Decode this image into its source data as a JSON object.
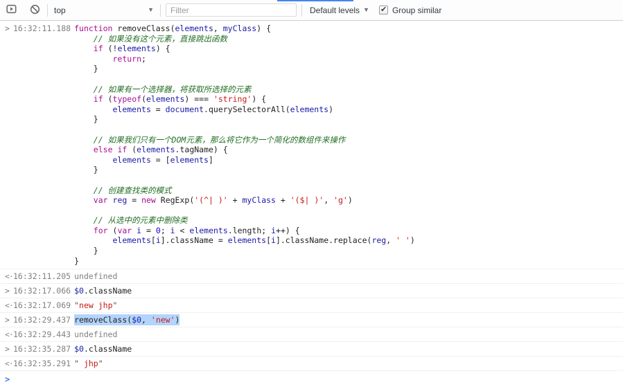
{
  "toolbar": {
    "context_selector": "top",
    "filter_placeholder": "Filter",
    "levels_label": "Default levels",
    "group_similar_label": "Group similar",
    "group_similar_checked": "✔"
  },
  "colors": {
    "accent": "#4285f4",
    "toolbar_border": "#cfcfcf",
    "row_border": "#f0f0f0",
    "keyword": "#aa0d91",
    "variable": "#1a1aa6",
    "string": "#c41a16",
    "number": "#1c00cf",
    "comment": "#236e25",
    "plain": "#222222",
    "quote": "#555555",
    "muted": "#808080",
    "prompt": "#367cf1",
    "selection": "#b3d4fc"
  },
  "console": {
    "command_glyph": ">",
    "result_glyph": "<·",
    "prompt_glyph": ">",
    "command_block": {
      "timestamp": "16:32:11.188",
      "lines": [
        [
          [
            "k",
            "function"
          ],
          [
            "pl",
            " removeClass("
          ],
          [
            "v",
            "elements"
          ],
          [
            "pl",
            ", "
          ],
          [
            "v",
            "myClass"
          ],
          [
            "pl",
            ") {"
          ]
        ],
        [
          [
            "c",
            "    // 如果没有这个元素，直接跳出函数"
          ]
        ],
        [
          [
            "pl",
            "    "
          ],
          [
            "k",
            "if"
          ],
          [
            "pl",
            " (!"
          ],
          [
            "v",
            "elements"
          ],
          [
            "pl",
            ") {"
          ]
        ],
        [
          [
            "pl",
            "        "
          ],
          [
            "k",
            "return"
          ],
          [
            "pl",
            ";"
          ]
        ],
        [
          [
            "pl",
            "    }"
          ]
        ],
        [],
        [
          [
            "c",
            "    // 如果有一个选择器，将获取所选择的元素"
          ]
        ],
        [
          [
            "pl",
            "    "
          ],
          [
            "k",
            "if"
          ],
          [
            "pl",
            " ("
          ],
          [
            "k",
            "typeof"
          ],
          [
            "pl",
            "("
          ],
          [
            "v",
            "elements"
          ],
          [
            "pl",
            ") === "
          ],
          [
            "s",
            "'string'"
          ],
          [
            "pl",
            ") {"
          ]
        ],
        [
          [
            "pl",
            "        "
          ],
          [
            "v",
            "elements"
          ],
          [
            "pl",
            " = "
          ],
          [
            "v",
            "document"
          ],
          [
            "pl",
            ".querySelectorAll("
          ],
          [
            "v",
            "elements"
          ],
          [
            "pl",
            ")"
          ]
        ],
        [
          [
            "pl",
            "    }"
          ]
        ],
        [],
        [
          [
            "c",
            "    // 如果我们只有一个DOM元素，那么将它作为一个简化的数组件来操作"
          ]
        ],
        [
          [
            "pl",
            "    "
          ],
          [
            "k",
            "else"
          ],
          [
            "pl",
            " "
          ],
          [
            "k",
            "if"
          ],
          [
            "pl",
            " ("
          ],
          [
            "v",
            "elements"
          ],
          [
            "pl",
            ".tagName) {"
          ]
        ],
        [
          [
            "pl",
            "        "
          ],
          [
            "v",
            "elements"
          ],
          [
            "pl",
            " = ["
          ],
          [
            "v",
            "elements"
          ],
          [
            "pl",
            "]"
          ]
        ],
        [
          [
            "pl",
            "    }"
          ]
        ],
        [],
        [
          [
            "c",
            "    // 创建查找类的模式"
          ]
        ],
        [
          [
            "pl",
            "    "
          ],
          [
            "k",
            "var"
          ],
          [
            "pl",
            " "
          ],
          [
            "v",
            "reg"
          ],
          [
            "pl",
            " = "
          ],
          [
            "k",
            "new"
          ],
          [
            "pl",
            " RegExp("
          ],
          [
            "s",
            "'(^| )'"
          ],
          [
            "pl",
            " + "
          ],
          [
            "v",
            "myClass"
          ],
          [
            "pl",
            " + "
          ],
          [
            "s",
            "'($| )'"
          ],
          [
            "pl",
            ", "
          ],
          [
            "s",
            "'g'"
          ],
          [
            "pl",
            ")"
          ]
        ],
        [],
        [
          [
            "c",
            "    // 从选中的元素中删除类"
          ]
        ],
        [
          [
            "pl",
            "    "
          ],
          [
            "k",
            "for"
          ],
          [
            "pl",
            " ("
          ],
          [
            "k",
            "var"
          ],
          [
            "pl",
            " "
          ],
          [
            "v",
            "i"
          ],
          [
            "pl",
            " = "
          ],
          [
            "n",
            "0"
          ],
          [
            "pl",
            "; "
          ],
          [
            "v",
            "i"
          ],
          [
            "pl",
            " < "
          ],
          [
            "v",
            "elements"
          ],
          [
            "pl",
            ".length; "
          ],
          [
            "v",
            "i"
          ],
          [
            "pl",
            "++) {"
          ]
        ],
        [
          [
            "pl",
            "        "
          ],
          [
            "v",
            "elements"
          ],
          [
            "pl",
            "["
          ],
          [
            "v",
            "i"
          ],
          [
            "pl",
            "].className = "
          ],
          [
            "v",
            "elements"
          ],
          [
            "pl",
            "["
          ],
          [
            "v",
            "i"
          ],
          [
            "pl",
            "].className.replace("
          ],
          [
            "v",
            "reg"
          ],
          [
            "pl",
            ", "
          ],
          [
            "s",
            "' '"
          ],
          [
            "pl",
            ")"
          ]
        ],
        [
          [
            "pl",
            "    }"
          ]
        ],
        [
          [
            "pl",
            "}"
          ]
        ]
      ]
    },
    "messages": [
      {
        "type": "result",
        "timestamp": "16:32:11.205",
        "tokens": [
          [
            "m",
            "undefined"
          ]
        ]
      },
      {
        "type": "command",
        "timestamp": "16:32:17.066",
        "tokens": [
          [
            "v",
            "$0"
          ],
          [
            "pl",
            ".className"
          ]
        ]
      },
      {
        "type": "result",
        "timestamp": "16:32:17.069",
        "tokens": [
          [
            "q",
            "\""
          ],
          [
            "s",
            "new jhp"
          ],
          [
            "q",
            "\""
          ]
        ]
      },
      {
        "type": "command",
        "timestamp": "16:32:29.437",
        "selected": true,
        "tokens": [
          [
            "pl",
            "removeClass("
          ],
          [
            "v",
            "$0"
          ],
          [
            "pl",
            ", "
          ],
          [
            "s",
            "'new'"
          ],
          [
            "pl",
            ")"
          ]
        ]
      },
      {
        "type": "result",
        "timestamp": "16:32:29.443",
        "tokens": [
          [
            "m",
            "undefined"
          ]
        ]
      },
      {
        "type": "command",
        "timestamp": "16:32:35.287",
        "tokens": [
          [
            "v",
            "$0"
          ],
          [
            "pl",
            ".className"
          ]
        ]
      },
      {
        "type": "result",
        "timestamp": "16:32:35.291",
        "tokens": [
          [
            "q",
            "\""
          ],
          [
            "s",
            " jhp"
          ],
          [
            "q",
            "\""
          ]
        ]
      }
    ]
  }
}
